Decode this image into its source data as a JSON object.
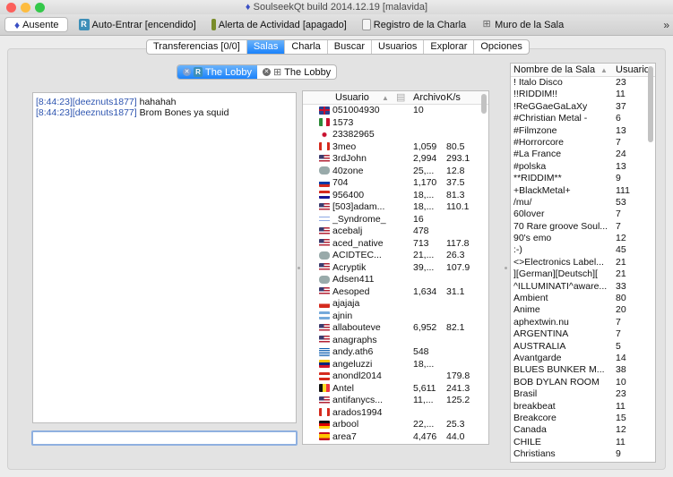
{
  "window": {
    "title": "SoulseekQt build 2014.12.19 [malavida]"
  },
  "toolbar": {
    "away": "Ausente",
    "auto_join": "Auto-Entrar [encendido]",
    "activity_alert": "Alerta de Actividad [apagado]",
    "chat_log": "Registro de la Charla",
    "room_wall": "Muro de la Sala",
    "more": "»"
  },
  "tabs": [
    "Transferencias [0/0]",
    "Salas",
    "Charla",
    "Buscar",
    "Usuarios",
    "Explorar",
    "Opciones"
  ],
  "active_tab": "Salas",
  "room_tabs": [
    {
      "label": "The Lobby",
      "icon": "R",
      "active": true
    },
    {
      "label": "The Lobby",
      "icon": "wall",
      "active": false
    }
  ],
  "chat": {
    "messages": [
      {
        "time": "[8:44:23]",
        "user": "[deeznuts1877]",
        "text": " hahahah"
      },
      {
        "time": "[8:44:23]",
        "user": "[deeznuts1877]",
        "text": " Brom Bones ya squid"
      }
    ],
    "input_value": ""
  },
  "users_table": {
    "headers": {
      "user": "Usuario",
      "sort": "▲",
      "files": "Archivo",
      "speed": "K/s"
    },
    "rows": [
      {
        "flag": "gb",
        "name": "051004930",
        "files": "10",
        "speed": ""
      },
      {
        "flag": "mx",
        "name": "1573",
        "files": "",
        "speed": ""
      },
      {
        "flag": "kr",
        "name": "23382965",
        "files": "",
        "speed": ""
      },
      {
        "flag": "ca",
        "name": "3meo",
        "files": "1,059",
        "speed": "80.5"
      },
      {
        "flag": "us",
        "name": "3rdJohn",
        "files": "2,994",
        "speed": "293.1"
      },
      {
        "flag": "none",
        "name": "40zone",
        "files": "25,...",
        "speed": "12.8"
      },
      {
        "flag": "ru",
        "name": "704",
        "files": "1,170",
        "speed": "37.5"
      },
      {
        "flag": "hr",
        "name": "956400",
        "files": "18,...",
        "speed": "81.3"
      },
      {
        "flag": "us",
        "name": "[503]adam...",
        "files": "18,...",
        "speed": "110.1"
      },
      {
        "flag": "il",
        "name": "_Syndrome_",
        "files": "16",
        "speed": ""
      },
      {
        "flag": "us",
        "name": "acebalj",
        "files": "478",
        "speed": ""
      },
      {
        "flag": "us",
        "name": "aced_native",
        "files": "713",
        "speed": "117.8"
      },
      {
        "flag": "none",
        "name": "ACIDTEC...",
        "files": "21,...",
        "speed": "26.3"
      },
      {
        "flag": "us",
        "name": "Acryptik",
        "files": "39,...",
        "speed": "107.9"
      },
      {
        "flag": "none",
        "name": "Adsen411",
        "files": "",
        "speed": ""
      },
      {
        "flag": "us",
        "name": "Aesoped",
        "files": "1,634",
        "speed": "31.1"
      },
      {
        "flag": "cl",
        "name": "ajajaja",
        "files": "",
        "speed": ""
      },
      {
        "flag": "ar",
        "name": "ajnin",
        "files": "",
        "speed": ""
      },
      {
        "flag": "us",
        "name": "allabouteve",
        "files": "6,952",
        "speed": "82.1"
      },
      {
        "flag": "us",
        "name": "anagraphs",
        "files": "",
        "speed": ""
      },
      {
        "flag": "gr",
        "name": "andy.ath6",
        "files": "548",
        "speed": ""
      },
      {
        "flag": "ve",
        "name": "angeluzzi",
        "files": "18,...",
        "speed": ""
      },
      {
        "flag": "at",
        "name": "anondl2014",
        "files": "",
        "speed": "179.8"
      },
      {
        "flag": "be",
        "name": "Antel",
        "files": "5,611",
        "speed": "241.3"
      },
      {
        "flag": "us",
        "name": "antifanycs...",
        "files": "11,...",
        "speed": "125.2"
      },
      {
        "flag": "ca",
        "name": "arados1994",
        "files": "",
        "speed": ""
      },
      {
        "flag": "de",
        "name": "arbool",
        "files": "22,...",
        "speed": "25.3"
      },
      {
        "flag": "es",
        "name": "area7",
        "files": "4,476",
        "speed": "44.0"
      }
    ]
  },
  "rooms_table": {
    "headers": {
      "name": "Nombre de la Sala",
      "sort": "▲",
      "users": "Usuario"
    },
    "rows": [
      {
        "name": "! Italo Disco",
        "users": "23"
      },
      {
        "name": "!!RIDDIM!!",
        "users": "11"
      },
      {
        "name": "!ReGGaeGaLaXy",
        "users": "37"
      },
      {
        "name": "#Christian Metal -",
        "users": "6"
      },
      {
        "name": "#Filmzone",
        "users": "13"
      },
      {
        "name": "#Horrorcore",
        "users": "7"
      },
      {
        "name": "#La France",
        "users": "24"
      },
      {
        "name": "#polska",
        "users": "13"
      },
      {
        "name": "**RIDDIM**",
        "users": "9"
      },
      {
        "name": "+BlackMetal+",
        "users": "111"
      },
      {
        "name": "/mu/",
        "users": "53"
      },
      {
        "name": "60lover",
        "users": "7"
      },
      {
        "name": "70 Rare groove Soul...",
        "users": "7"
      },
      {
        "name": "90's emo",
        "users": "12"
      },
      {
        "name": ":-)",
        "users": "45"
      },
      {
        "name": "<>Electronics Label...",
        "users": "21"
      },
      {
        "name": "][German][Deutsch][",
        "users": "21"
      },
      {
        "name": "^ILLUMINATI^aware...",
        "users": "33"
      },
      {
        "name": "Ambient",
        "users": "80"
      },
      {
        "name": "Anime",
        "users": "20"
      },
      {
        "name": "aphextwin.nu",
        "users": "7"
      },
      {
        "name": "ARGENTINA",
        "users": "7"
      },
      {
        "name": "AUSTRALIA",
        "users": "5"
      },
      {
        "name": "Avantgarde",
        "users": "14"
      },
      {
        "name": "BLUES BUNKER M...",
        "users": "38"
      },
      {
        "name": "BOB DYLAN ROOM",
        "users": "10"
      },
      {
        "name": "Brasil",
        "users": "23"
      },
      {
        "name": "breakbeat",
        "users": "11"
      },
      {
        "name": "Breakcore",
        "users": "15"
      },
      {
        "name": "Canada",
        "users": "12"
      },
      {
        "name": "CHILE",
        "users": "11"
      },
      {
        "name": "Christians",
        "users": "9"
      }
    ]
  },
  "colors": {
    "accent": "#1a82fb",
    "timestamp": "#2e55b0"
  }
}
